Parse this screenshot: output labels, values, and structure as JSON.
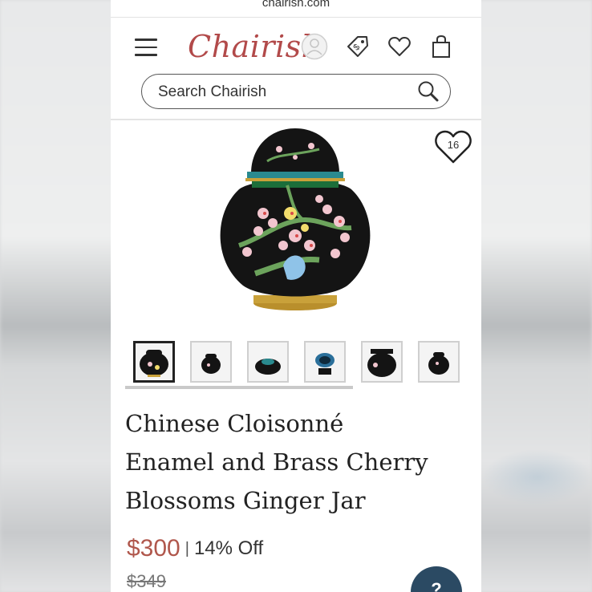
{
  "browser": {
    "url_fragment": "chairish.com"
  },
  "header": {
    "logo": "Chairish",
    "icons": [
      "menu-icon",
      "avatar-icon",
      "price-tag-icon",
      "heart-icon",
      "shopping-bag-icon"
    ],
    "tag_icon_label": "$"
  },
  "search": {
    "placeholder": "Search Chairish"
  },
  "product": {
    "favorites_count": "16",
    "title_lines": [
      "Chinese Cloisonné",
      "Enamel and Brass Cherry",
      "Blossoms Ginger Jar"
    ],
    "price": "$300",
    "separator": "|",
    "discount": "14% Off",
    "original_price": "$349",
    "thumbnail_count": 6,
    "active_thumbnail": 1
  },
  "colors": {
    "brand": "#b24a4a",
    "price": "#b0574c",
    "help_button": "#2b4a63",
    "jar_body": "#141414",
    "jar_brass": "#c9a13a"
  }
}
